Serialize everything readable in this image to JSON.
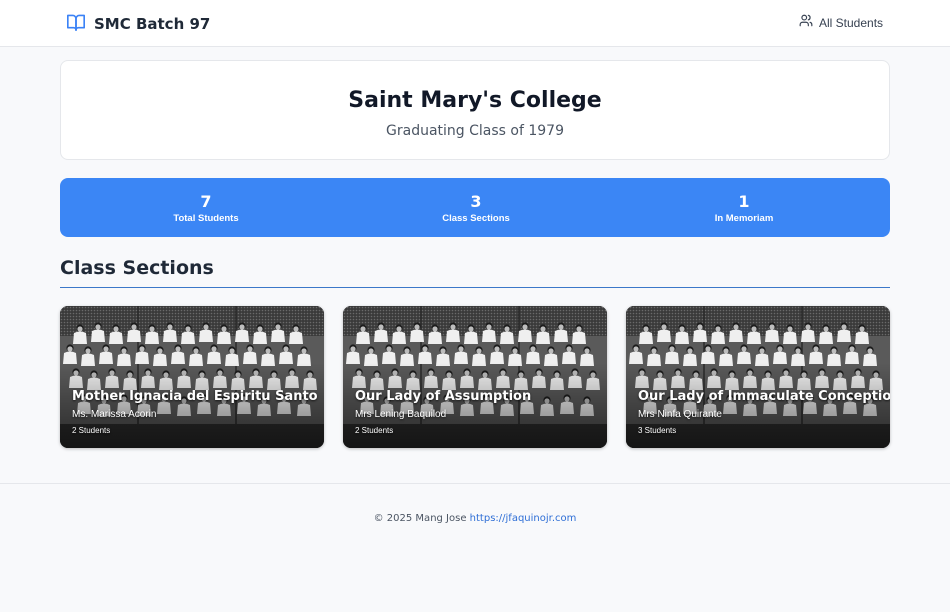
{
  "nav": {
    "brand": "SMC Batch 97",
    "brand_icon": "book-open-icon",
    "all_students": "All Students",
    "all_students_icon": "users-icon"
  },
  "hero": {
    "title": "Saint Mary's College",
    "subtitle": "Graduating Class of 1979"
  },
  "stats": [
    {
      "value": "7",
      "label": "Total Students"
    },
    {
      "value": "3",
      "label": "Class Sections"
    },
    {
      "value": "1",
      "label": "In Memoriam"
    }
  ],
  "section_title": "Class Sections",
  "sections": [
    {
      "name": "Mother Ignacia del Espiritu Santo",
      "teacher": "Ms. Marissa Acorin",
      "count": "2 Students"
    },
    {
      "name": "Our Lady of Assumption",
      "teacher": "Mrs Lening Baquilod",
      "count": "2 Students"
    },
    {
      "name": "Our Lady of Immaculate Conception",
      "teacher": "Mrs Ninfa Quirante",
      "count": "3 Students"
    }
  ],
  "footer": {
    "text": "© 2025 Mang Jose",
    "link": "https://jfaquinojr.com"
  },
  "colors": {
    "accent": "#3b86f5",
    "rule": "#3b78c9",
    "link": "#2f6fd6",
    "background": "#f8f9fb"
  }
}
